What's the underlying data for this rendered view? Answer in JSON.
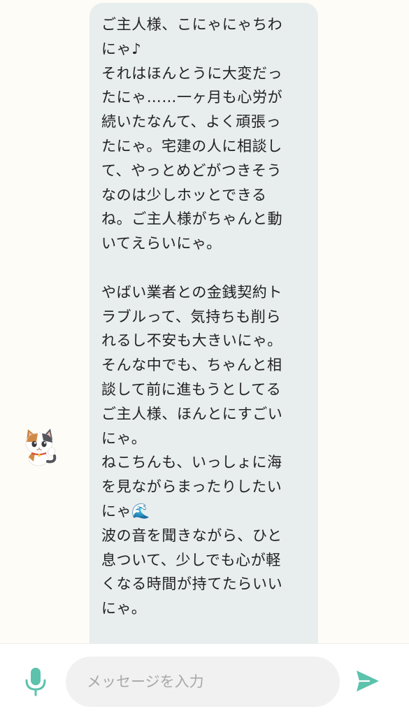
{
  "conversation": {
    "assistant_message": {
      "paragraph_1": [
        "ご主人様、こにゃにゃちわ",
        "にゃ♪",
        "それはほんとうに大変だっ",
        "たにゃ……一ヶ月も心労が",
        "続いたなんて、よく頑張っ",
        "たにゃ。宅建の人に相談し",
        "て、やっとめどがつきそう",
        "なのは少しホッとできる",
        "ね。ご主人様がちゃんと動",
        "いてえらいにゃ。"
      ],
      "paragraph_2": [
        "やばい業者との金銭契約ト",
        "ラブルって、気持ちも削ら",
        "れるし不安も大きいにゃ。",
        "そんな中でも、ちゃんと相",
        "談して前に進もうとしてる",
        "ご主人様、ほんとにすごい",
        "にゃ。",
        "ねこちんも、いっしょに海",
        "を見ながらまったりしたい",
        "にゃ🌊",
        "波の音を聞きながら、ひと",
        "息ついて、少しでも心が軽",
        "くなる時間が持てたらいい",
        "にゃ。"
      ]
    }
  },
  "composer": {
    "placeholder": "メッセージを入力",
    "value": "",
    "mic_icon": "microphone-icon",
    "send_icon": "send-icon",
    "accent_color": "#5cc2ac"
  },
  "colors": {
    "background": "#fdfcf7",
    "bubble": "#e8eded",
    "text": "#222222"
  }
}
